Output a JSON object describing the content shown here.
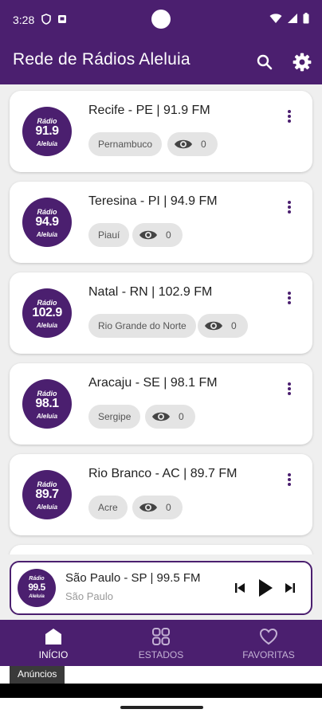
{
  "status_bar": {
    "time": "3:28"
  },
  "app_bar": {
    "title": "Rede de Rádios Aleluia"
  },
  "radios": [
    {
      "logo_top": "Rádio",
      "frequency_short": "91.9",
      "logo_bottom": "Aleluia",
      "title": "Recife - PE | 91.9 FM",
      "state": "Pernambuco",
      "views": "0"
    },
    {
      "logo_top": "Rádio",
      "frequency_short": "94.9",
      "logo_bottom": "Aleluia",
      "title": "Teresina - PI | 94.9 FM",
      "state": "Piauí",
      "views": "0"
    },
    {
      "logo_top": "Rádio",
      "frequency_short": "102.9",
      "logo_bottom": "Aleluia",
      "title": "Natal - RN | 102.9 FM",
      "state": "Rio Grande do Norte",
      "views": "0"
    },
    {
      "logo_top": "Rádio",
      "frequency_short": "98.1",
      "logo_bottom": "Aleluia",
      "title": "Aracaju - SE | 98.1 FM",
      "state": "Sergipe",
      "views": "0"
    },
    {
      "logo_top": "Rádio",
      "frequency_short": "89.7",
      "logo_bottom": "Aleluia",
      "title": "Rio Branco - AC | 89.7 FM",
      "state": "Acre",
      "views": "0"
    }
  ],
  "player": {
    "logo_top": "Rádio",
    "frequency_short": "99.5",
    "logo_bottom": "Aleluia",
    "title": "São Paulo - SP | 99.5 FM",
    "subtitle": "São Paulo"
  },
  "bottom_nav": {
    "items": [
      {
        "label": "INÍCIO",
        "icon": "home-icon",
        "active": true
      },
      {
        "label": "ESTADOS",
        "icon": "grid-icon",
        "active": false
      },
      {
        "label": "FAVORITAS",
        "icon": "heart-icon",
        "active": false
      }
    ]
  },
  "ads": {
    "label": "Anúncios"
  },
  "colors": {
    "primary": "#4b1f6f",
    "background": "#efefef",
    "chip": "#e4e4e4"
  }
}
